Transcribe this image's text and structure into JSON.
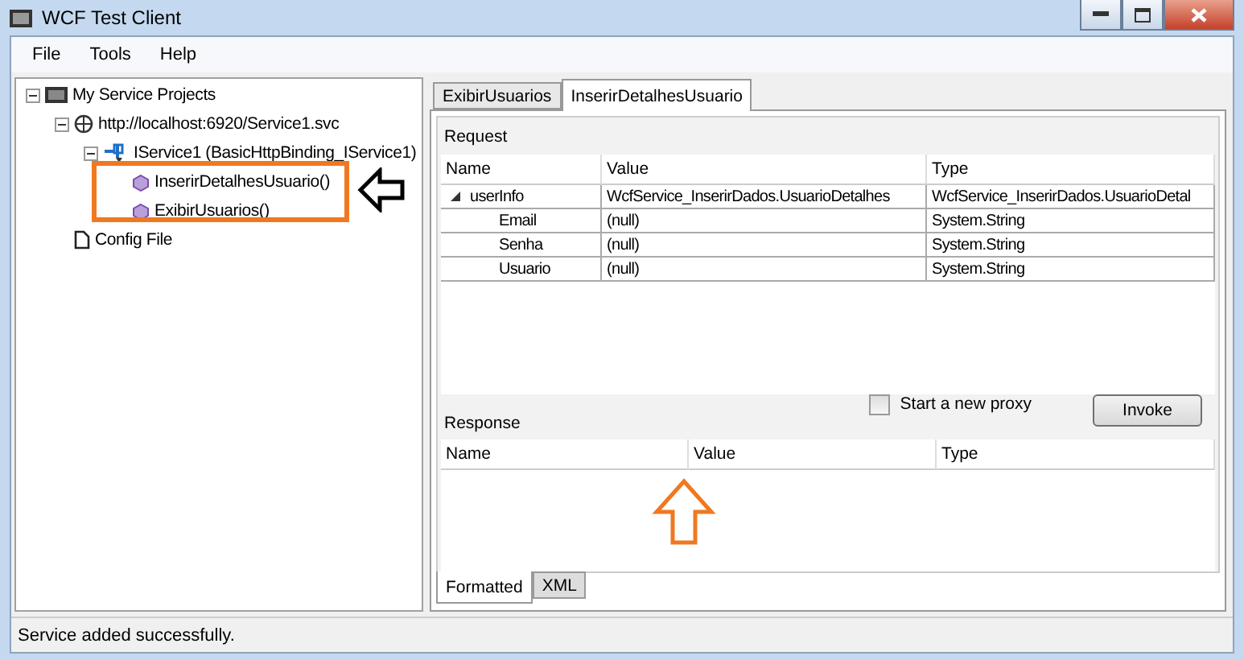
{
  "window": {
    "title": "WCF Test Client"
  },
  "menu": [
    "File",
    "Tools",
    "Help"
  ],
  "tree": [
    {
      "label": "My Service Projects",
      "kind": "project",
      "expanded": true,
      "children": [
        {
          "label": "http://localhost:6920/Service1.svc",
          "kind": "endpoint",
          "expanded": true,
          "children": [
            {
              "label": "IService1 (BasicHttpBinding_IService1)",
              "kind": "contract",
              "expanded": true,
              "children": [
                {
                  "label": "InserirDetalhesUsuario()",
                  "kind": "method"
                },
                {
                  "label": "ExibirUsuarios()",
                  "kind": "method"
                }
              ]
            }
          ]
        },
        {
          "label": "Config File",
          "kind": "file"
        }
      ]
    }
  ],
  "tabs": [
    {
      "label": "ExibirUsuarios",
      "selected": false
    },
    {
      "label": "InserirDetalhesUsuario",
      "selected": true
    }
  ],
  "request": {
    "title": "Request",
    "columns": [
      "Name",
      "Value",
      "Type"
    ],
    "rows": [
      {
        "name": "userInfo",
        "value": "WcfService_InserirDados.UsuarioDetalhes",
        "type": "WcfService_InserirDados.UsuarioDetal",
        "expanded": true,
        "children": [
          {
            "name": "Email",
            "value": "(null)",
            "type": "System.String"
          },
          {
            "name": "Senha",
            "value": "(null)",
            "type": "System.String"
          },
          {
            "name": "Usuario",
            "value": "(null)",
            "type": "System.String"
          }
        ]
      }
    ]
  },
  "response": {
    "title": "Response",
    "columns": [
      "Name",
      "Value",
      "Type"
    ]
  },
  "proxy": {
    "label": "Start a new proxy",
    "checked": false
  },
  "invoke": "Invoke",
  "bottom_tabs": [
    {
      "label": "Formatted",
      "selected": true
    },
    {
      "label": "XML",
      "selected": false
    }
  ],
  "status_bar": "Service added successfully."
}
